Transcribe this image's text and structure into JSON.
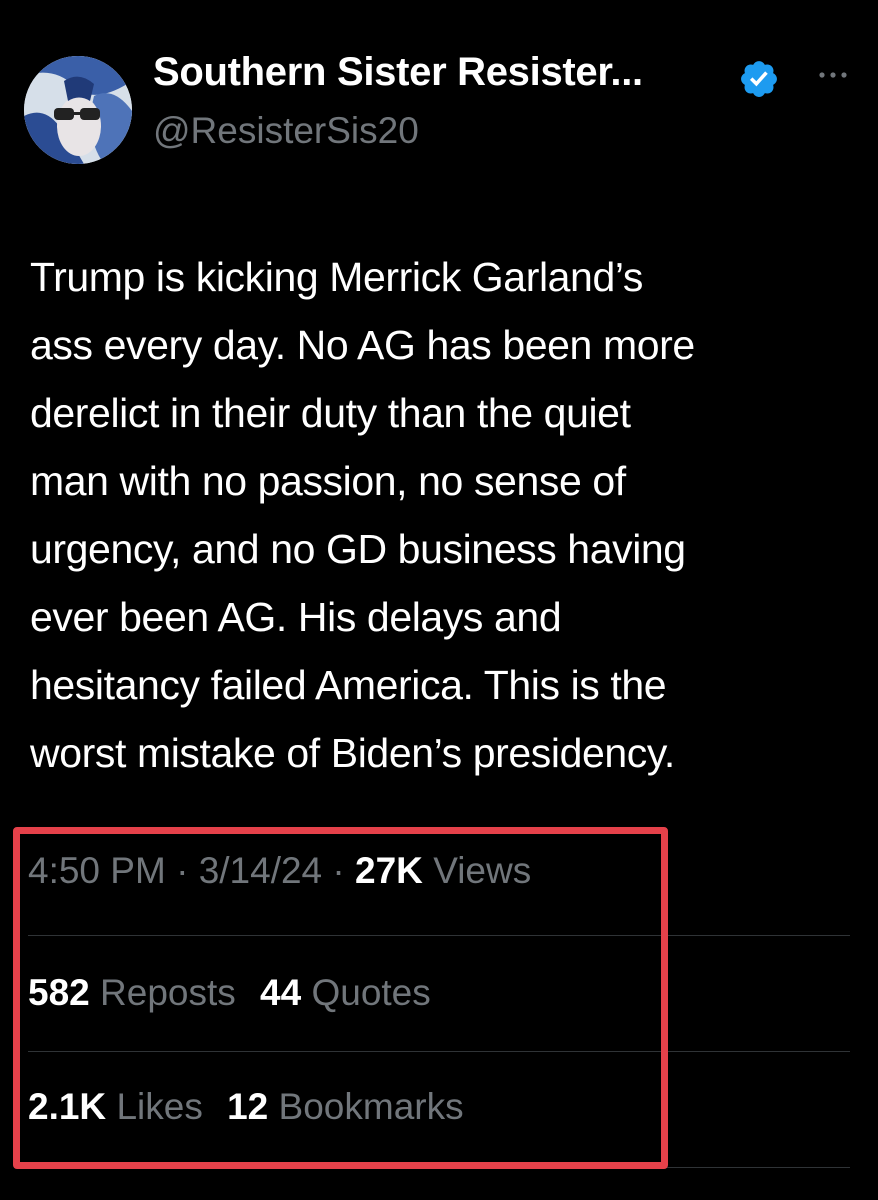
{
  "author": {
    "display_name": "Southern Sister Resister...",
    "handle": "@ResisterSis20",
    "verified": true,
    "verified_color": "#1d9bf0",
    "avatar_icon": "profile-avatar"
  },
  "header": {
    "more_icon": "more-horizontal-icon"
  },
  "tweet": {
    "text_lines": [
      "Trump is kicking Merrick Garland’s",
      "ass every day. No AG has been more",
      "derelict in their duty than the quiet",
      "man with no passion, no sense of",
      "urgency, and no GD business having",
      "ever been AG. His delays and",
      "hesitancy failed America. This is the",
      "worst mistake of Biden’s presidency."
    ]
  },
  "meta": {
    "time": "4:50 PM",
    "separator": " · ",
    "date": "3/14/24",
    "views_count": "27K",
    "views_label": "Views"
  },
  "stats": {
    "reposts_count": "582",
    "reposts_label": "Reposts",
    "quotes_count": "44",
    "quotes_label": "Quotes",
    "likes_count": "2.1K",
    "likes_label": "Likes",
    "bookmarks_count": "12",
    "bookmarks_label": "Bookmarks"
  },
  "colors": {
    "background": "#000000",
    "primary_text": "#ffffff",
    "secondary_text": "#71767b",
    "highlight_border": "#e5414a",
    "divider": "#2f3336"
  }
}
